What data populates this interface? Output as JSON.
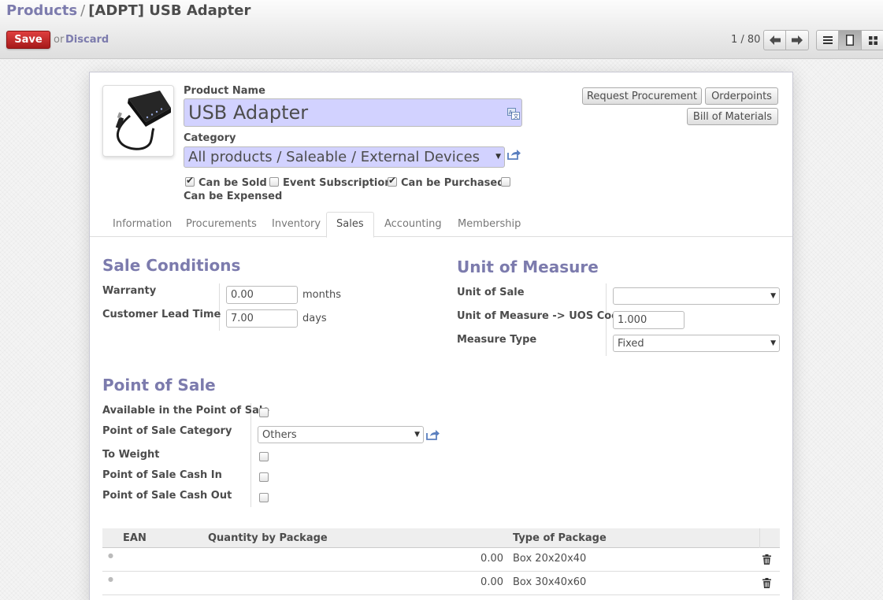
{
  "breadcrumb": {
    "parent": "Products",
    "separator": "/",
    "current": "[ADPT] USB Adapter"
  },
  "toolbar": {
    "save_label": "Save",
    "or_label": "or",
    "discard_label": "Discard"
  },
  "pager": {
    "value": "1 / 80"
  },
  "icons": {
    "pager_prev": "arrow-left-icon",
    "pager_next": "arrow-right-icon",
    "view_list": "list-view-icon",
    "view_form": "form-view-icon",
    "view_kanban": "kanban-view-icon",
    "translate": "translate-icon",
    "external": "external-link-icon",
    "delete": "trash-icon"
  },
  "header_buttons": {
    "request_procurement": "Request Procurement",
    "orderpoints": "Orderpoints",
    "bill_of_materials": "Bill of Materials"
  },
  "product": {
    "name_label": "Product Name",
    "name_value": "USB Adapter",
    "category_label": "Category",
    "category_value": "All products / Saleable / External Devices",
    "flags": {
      "can_be_sold": {
        "label": "Can be Sold",
        "checked": true
      },
      "event_subscription": {
        "label": "Event Subscription",
        "checked": false
      },
      "can_be_purchased": {
        "label": "Can be Purchased",
        "checked": true
      },
      "can_be_expensed": {
        "label": "Can be Expensed",
        "checked": false
      }
    }
  },
  "tabs": [
    "Information",
    "Procurements",
    "Inventory",
    "Sales",
    "Accounting",
    "Membership"
  ],
  "active_tab": "Sales",
  "sale_conditions": {
    "title": "Sale Conditions",
    "warranty_label": "Warranty",
    "warranty_value": "0.00",
    "warranty_unit": "months",
    "lead_time_label": "Customer Lead Time",
    "lead_time_value": "7.00",
    "lead_time_unit": "days"
  },
  "unit_of_measure": {
    "title": "Unit of Measure",
    "unit_of_sale_label": "Unit of Sale",
    "unit_of_sale_value": "",
    "uos_coeff_label": "Unit of Measure -> UOS Coeff",
    "uos_coeff_value": "1.000",
    "measure_type_label": "Measure Type",
    "measure_type_value": "Fixed"
  },
  "point_of_sale": {
    "title": "Point of Sale",
    "available_label": "Available in the Point of Sale",
    "available_checked": false,
    "category_label": "Point of Sale Category",
    "category_value": "Others",
    "to_weight_label": "To Weight",
    "to_weight_checked": false,
    "cash_in_label": "Point of Sale Cash In",
    "cash_in_checked": false,
    "cash_out_label": "Point of Sale Cash Out",
    "cash_out_checked": false
  },
  "packaging": {
    "columns": [
      "EAN",
      "Quantity by Package",
      "Type of Package"
    ],
    "rows": [
      {
        "ean": "",
        "qty": "0.00",
        "type": "Box 20x20x40"
      },
      {
        "ean": "",
        "qty": "0.00",
        "type": "Box 30x40x60"
      }
    ]
  }
}
